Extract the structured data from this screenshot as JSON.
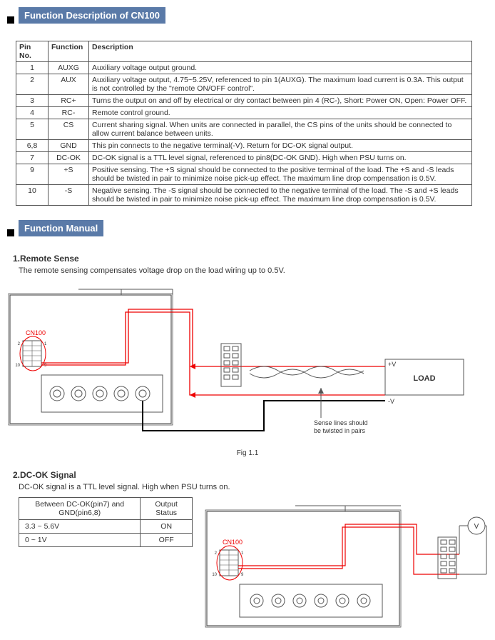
{
  "headers": {
    "section1": "Function Description of CN100",
    "section2": "Function Manual"
  },
  "pin_table": {
    "cols": [
      "Pin No.",
      "Function",
      "Description"
    ],
    "rows": [
      {
        "pin": "1",
        "func": "AUXG",
        "desc": "Auxiliary voltage output ground."
      },
      {
        "pin": "2",
        "func": "AUX",
        "desc": "Auxiliary voltage output, 4.75~5.25V, referenced to pin 1(AUXG). The maximum load current is 0.3A. This output is not controlled by the \"remote ON/OFF control\"."
      },
      {
        "pin": "3",
        "func": "RC+",
        "desc": "Turns the output on and off by electrical or dry contact between pin 4 (RC-), Short: Power ON, Open: Power OFF."
      },
      {
        "pin": "4",
        "func": "RC-",
        "desc": "Remote control ground."
      },
      {
        "pin": "5",
        "func": "CS",
        "desc": "Current sharing signal. When units are connected in parallel, the CS pins of the units should be connected to allow current balance between units."
      },
      {
        "pin": "6,8",
        "func": "GND",
        "desc": "This pin connects to the negative terminal(-V). Return for DC-OK signal output."
      },
      {
        "pin": "7",
        "func": "DC-OK",
        "desc": "DC-OK signal is a TTL level signal, referenced to pin8(DC-OK GND). High when PSU turns on."
      },
      {
        "pin": "9",
        "func": "+S",
        "desc": "Positive sensing. The +S signal should be connected to the positive terminal of the load. The +S and -S leads should be twisted in pair to minimize noise pick-up effect. The maximum line drop compensation is 0.5V."
      },
      {
        "pin": "10",
        "func": "-S",
        "desc": "Negative sensing. The -S signal should be connected to the negative terminal of the load. The -S and +S leads should be twisted in pair to minimize noise pick-up effect. The maximum line drop compensation is 0.5V."
      }
    ]
  },
  "remote_sense": {
    "heading": "1.Remote Sense",
    "text": "The remote sensing compensates voltage drop on the load wiring up to 0.5V.",
    "fig_caption": "Fig 1.1",
    "labels": {
      "cn100": "CN100",
      "plus_v": "+V",
      "minus_v": "-V",
      "load": "LOAD",
      "sense_note": "Sense lines should be twisted in pairs"
    }
  },
  "dc_ok": {
    "heading": "2.DC-OK Signal",
    "text": "DC-OK signal is a TTL level signal. High when PSU turns on.",
    "table": {
      "cols": [
        "Between DC-OK(pin7) and GND(pin6,8)",
        "Output Status"
      ],
      "rows": [
        {
          "range": "3.3 ~ 5.6V",
          "status": "ON"
        },
        {
          "range": "0 ~ 1V",
          "status": "OFF"
        }
      ]
    },
    "cn100": "CN100"
  }
}
